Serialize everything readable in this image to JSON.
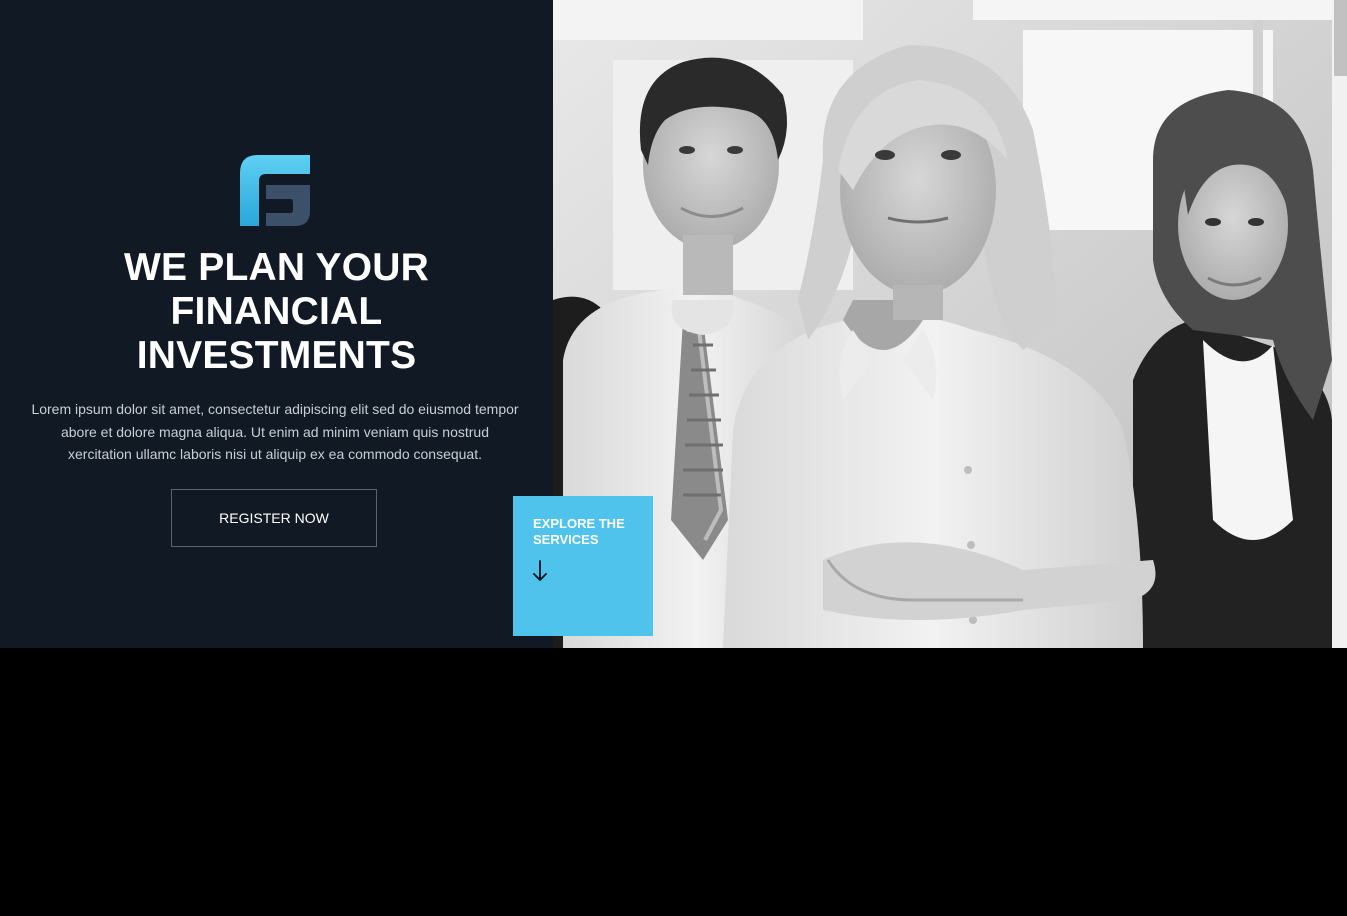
{
  "hero": {
    "logo_icon": "stylized-f-logo-icon",
    "headline_lines": [
      "WE PLAN YOUR",
      "FINANCIAL",
      "INVESTMENTS"
    ],
    "lead": "Lorem ipsum dolor sit amet, consectetur adipiscing elit sed do eiusmod tempor abore et dolore magna aliqua. Ut enim ad minim veniam quis nostrud xercitation ullamc laboris nisi ut aliquip ex ea commodo consequat.",
    "register_label": "REGISTER NOW",
    "photo_icon": "business-team-photo"
  },
  "explore": {
    "label": "EXPLORE THE SERVICES",
    "arrow_icon": "arrow-down-icon"
  },
  "colors": {
    "panel_bg": "#111924",
    "accent": "#4fc3ec",
    "text_muted": "#c9ced5"
  }
}
